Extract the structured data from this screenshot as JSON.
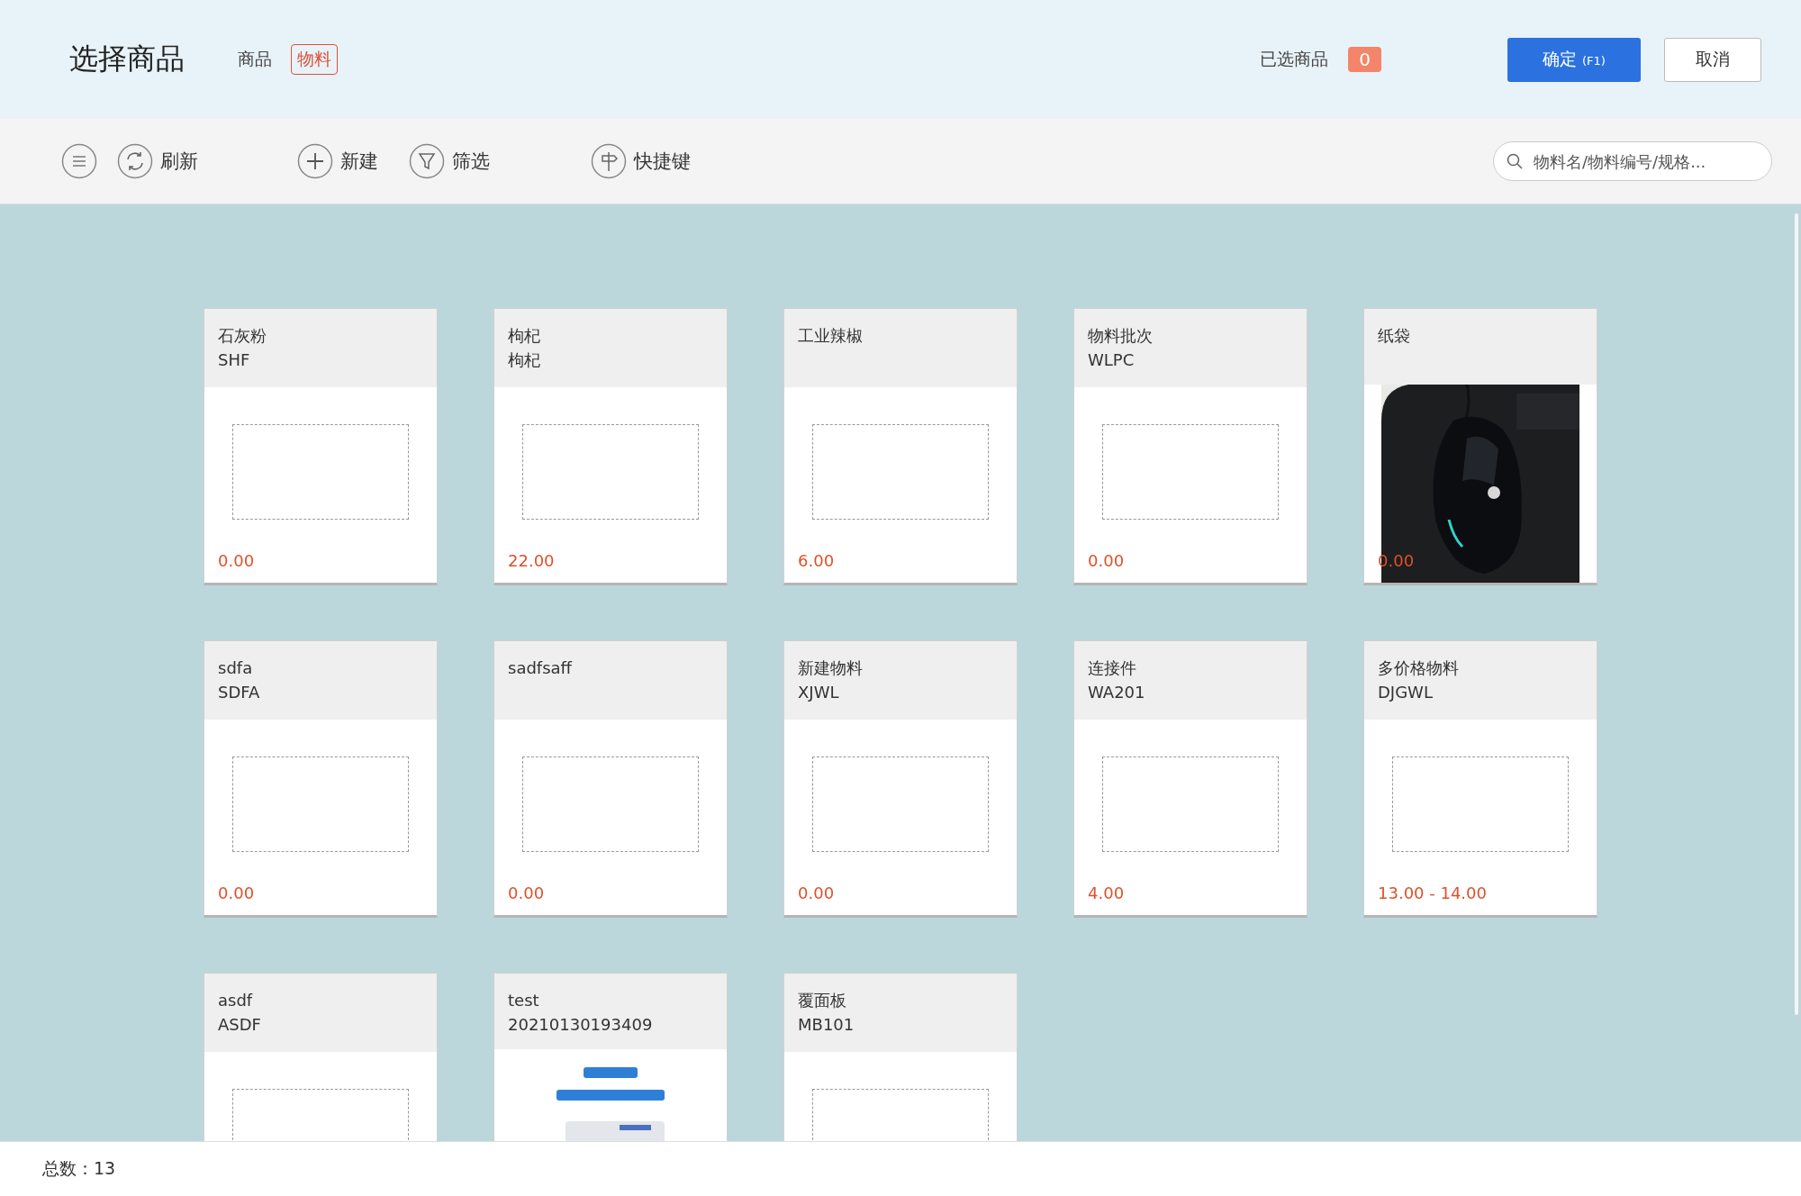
{
  "header": {
    "title": "选择商品",
    "tabs": [
      {
        "label": "商品",
        "selected": false
      },
      {
        "label": "物料",
        "selected": true
      }
    ],
    "selected_label": "已选商品",
    "selected_count": "0",
    "confirm": {
      "label": "确定",
      "shortcut": "(F1)"
    },
    "cancel": "取消"
  },
  "toolbar": {
    "items": [
      {
        "kind": "menu"
      },
      {
        "kind": "refresh",
        "label": "刷新"
      },
      {
        "kind": "new",
        "label": "新建"
      },
      {
        "kind": "filter",
        "label": "筛选"
      },
      {
        "kind": "shortcut",
        "label": "快捷键"
      }
    ],
    "search": {
      "placeholder": "物料名/物料编号/规格..."
    }
  },
  "cards": [
    {
      "name": "石灰粉",
      "code": "SHF",
      "price": "0.00"
    },
    {
      "name": "枸杞",
      "code": "枸杞",
      "price": "22.00"
    },
    {
      "name": "工业辣椒",
      "price": "6.00"
    },
    {
      "name": "物料批次",
      "code": "WLPC",
      "price": "0.00"
    },
    {
      "name": "纸袋",
      "kind": "picture",
      "price": "0.00"
    },
    {
      "name": "sdfa",
      "code": "SDFA",
      "price": "0.00"
    },
    {
      "name": "sadfsaff",
      "price": "0.00"
    },
    {
      "name": "新建物料",
      "code": "XJWL",
      "price": "0.00"
    },
    {
      "name": "连接件",
      "code": "WA201",
      "price": "4.00"
    },
    {
      "name": "多价格物料",
      "code": "DJGWL",
      "price": "13.00 - 14.00"
    },
    {
      "name": "asdf",
      "code": "ASDF"
    },
    {
      "name": "test",
      "code": "20210130193409",
      "kind": "picture"
    },
    {
      "name": "覆面板",
      "code": "MB101"
    }
  ],
  "footer": {
    "total": "总数：13"
  }
}
